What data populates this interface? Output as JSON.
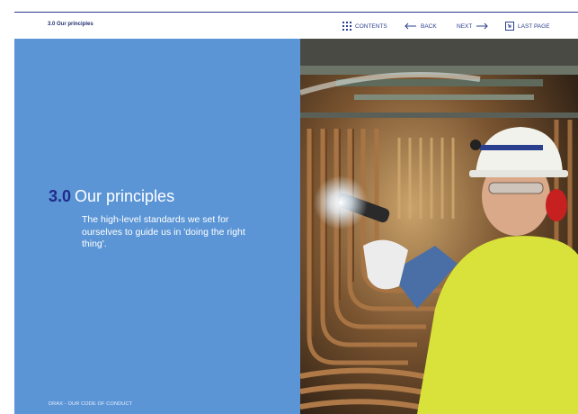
{
  "header": {
    "section_label": "3.0 Our principles",
    "nav": {
      "contents": "CONTENTS",
      "back": "BACK",
      "next": "NEXT",
      "last_page": "LAST PAGE"
    }
  },
  "main": {
    "section_number": "3.0",
    "section_title": "Our principles",
    "subtitle": "The high-level standards we set for ourselves to guide us in 'doing the right thing'.",
    "footer": "DRAX - OUR CODE OF CONDUCT"
  },
  "icons": {
    "contents": "grid-icon",
    "back": "arrow-left-icon",
    "next": "arrow-right-icon",
    "last_page": "last-page-icon"
  },
  "colors": {
    "panel_blue": "#5b95d6",
    "accent_navy": "#1f2c8a",
    "nav_text": "#2b3f8f",
    "helmet_yellow": "#d8e23a"
  }
}
